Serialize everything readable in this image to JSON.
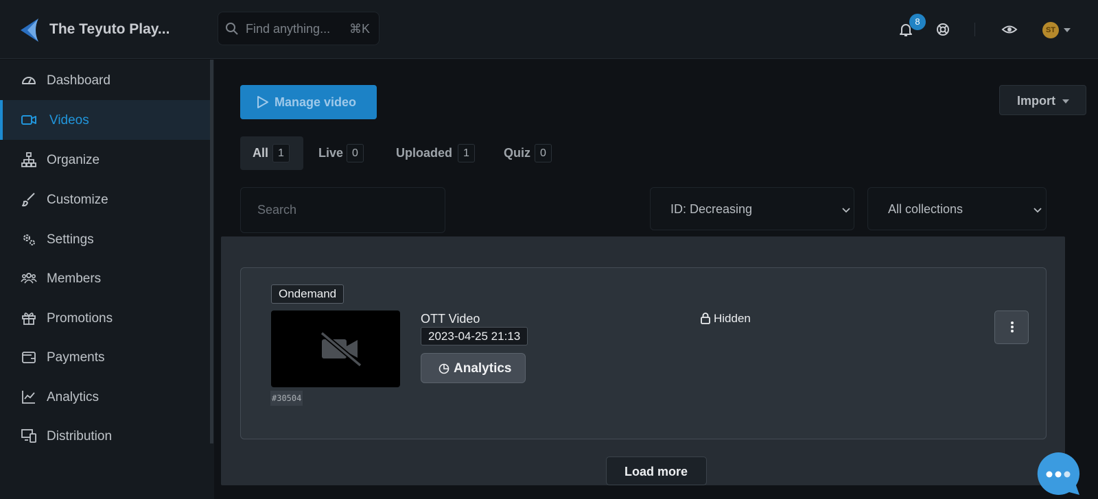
{
  "app": {
    "brand": "The Teyuto Play..."
  },
  "topbar": {
    "search_placeholder": "Find anything...",
    "search_shortcut": "⌘K",
    "notifications_count": "8",
    "avatar_initials": "ST"
  },
  "sidebar": {
    "items": [
      {
        "label": "Dashboard",
        "icon": "gauge-icon"
      },
      {
        "label": "Videos",
        "icon": "video-camera-icon",
        "active": true
      },
      {
        "label": "Organize",
        "icon": "sitemap-icon"
      },
      {
        "label": "Customize",
        "icon": "brush-icon"
      },
      {
        "label": "Settings",
        "icon": "gears-icon"
      },
      {
        "label": "Members",
        "icon": "users-icon"
      },
      {
        "label": "Promotions",
        "icon": "gift-icon"
      },
      {
        "label": "Payments",
        "icon": "wallet-icon"
      },
      {
        "label": "Analytics",
        "icon": "line-chart-icon"
      },
      {
        "label": "Distribution",
        "icon": "devices-icon"
      }
    ]
  },
  "main": {
    "manage_button": "Manage video",
    "import_button": "Import",
    "tabs": [
      {
        "label": "All",
        "count": "1"
      },
      {
        "label": "Live",
        "count": "0"
      },
      {
        "label": "Uploaded",
        "count": "1"
      },
      {
        "label": "Quiz",
        "count": "0"
      }
    ],
    "search_placeholder": "Search",
    "sort_select": "ID: Decreasing",
    "collection_select": "All collections",
    "video": {
      "type_tag": "Ondemand",
      "title": "OTT Video",
      "date": "2023-04-25 21:13",
      "id": "#30504",
      "analytics_label": "Analytics",
      "visibility": "Hidden"
    },
    "load_more": "Load more"
  },
  "colors": {
    "accent": "#1c82c6",
    "active_text": "#2196dc",
    "background": "#0f1216",
    "panel": "#272d34"
  }
}
